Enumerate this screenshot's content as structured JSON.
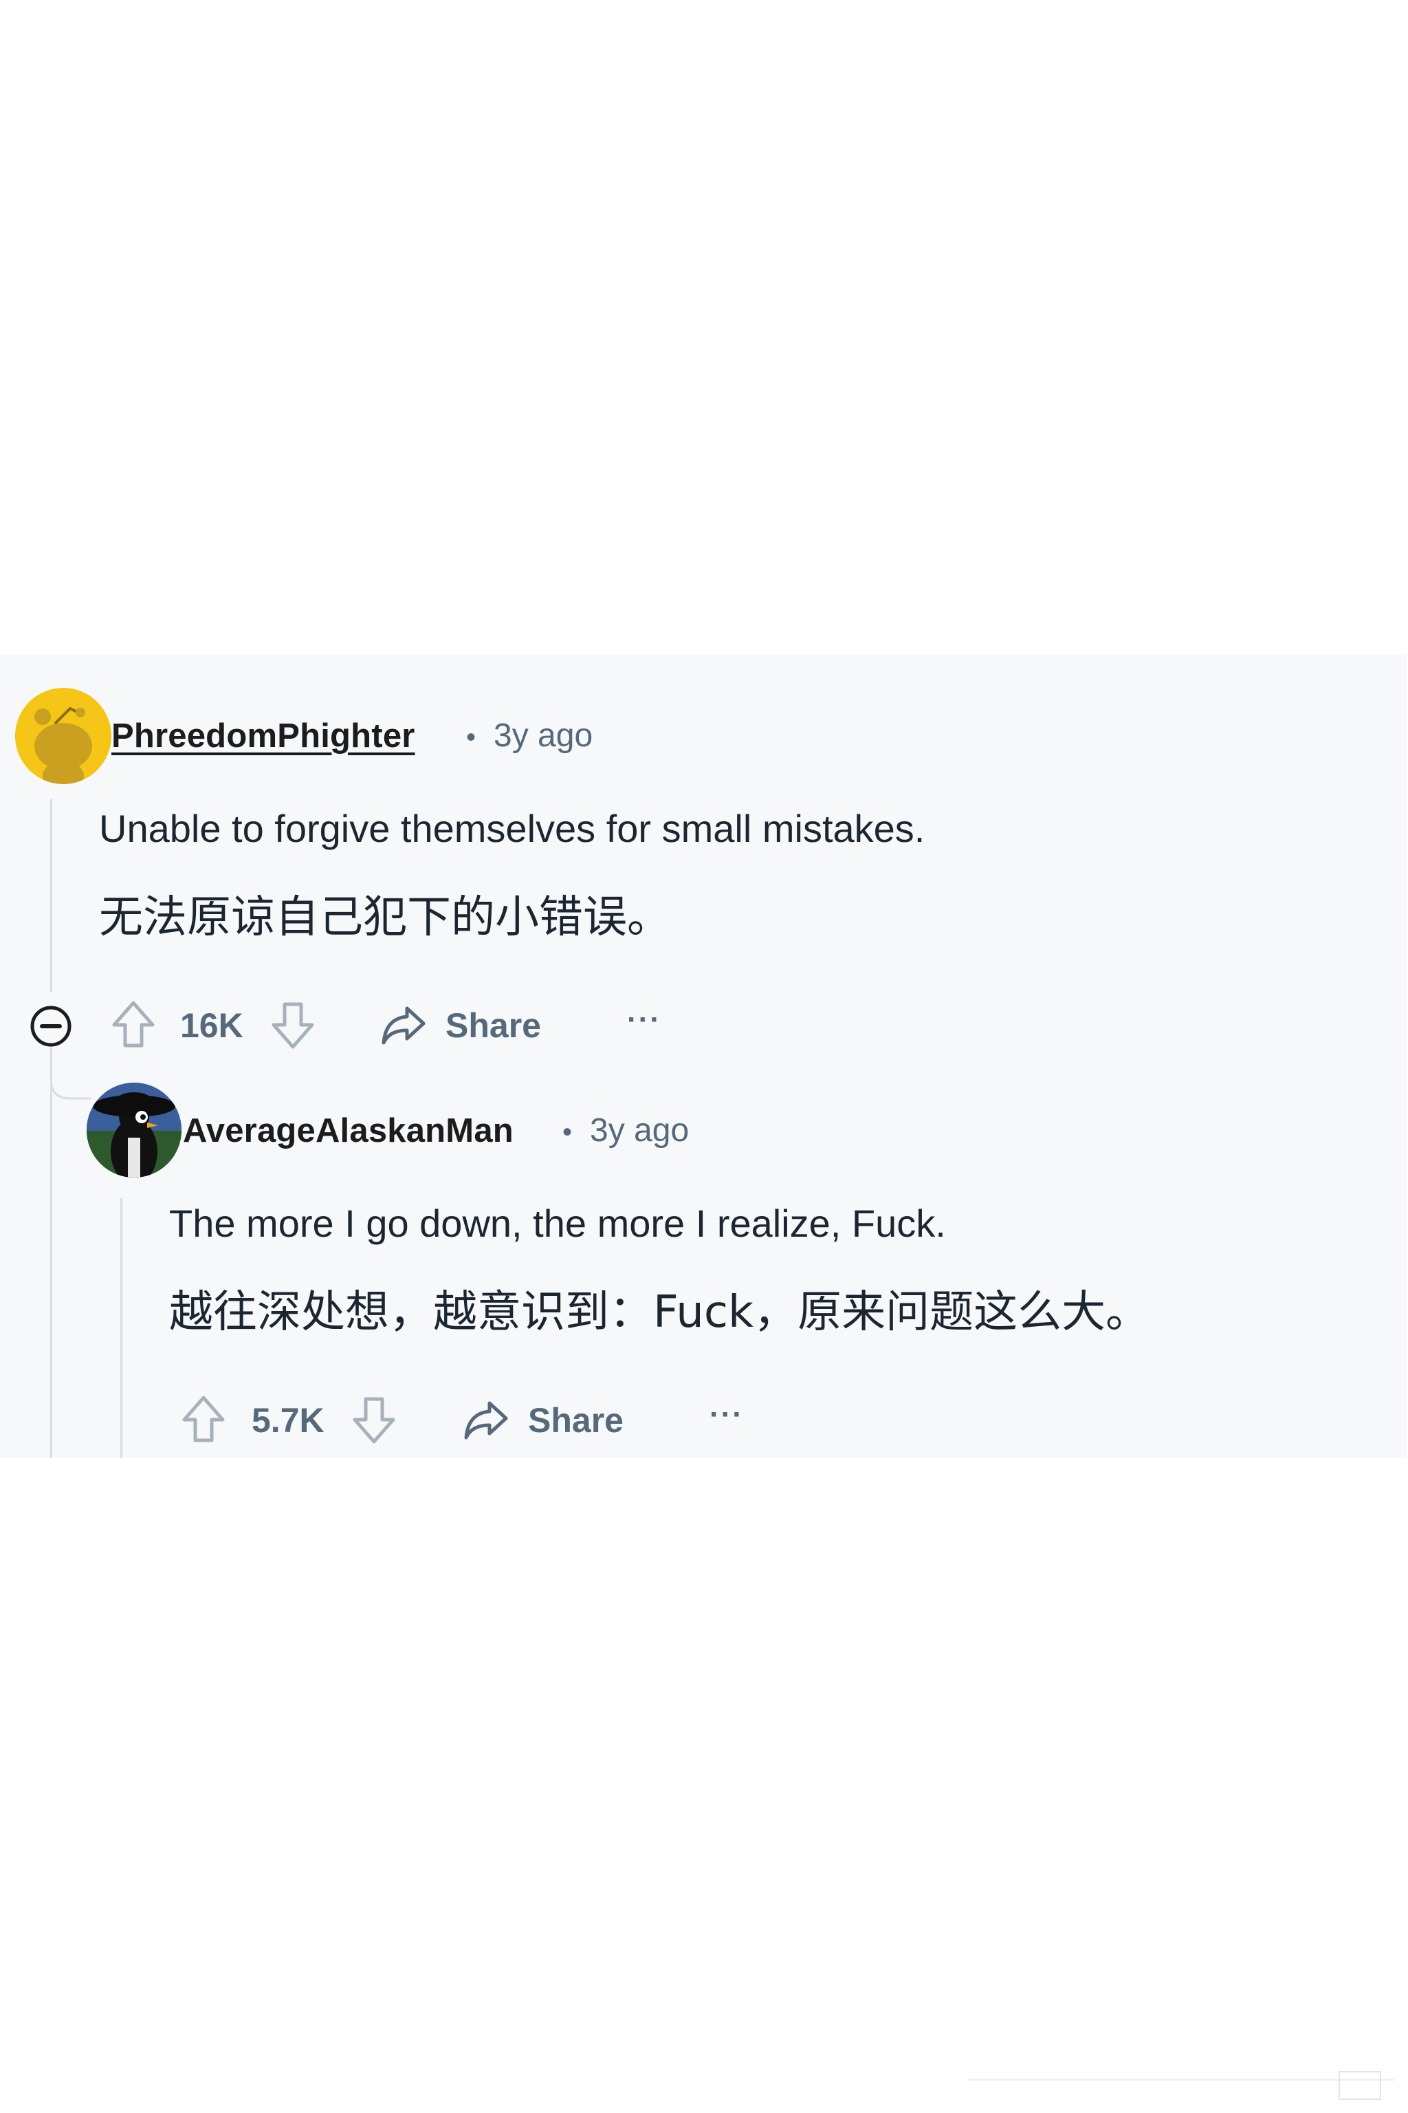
{
  "comments": [
    {
      "username": "PhreedomPhighter",
      "time": "3y ago",
      "separator": "•",
      "text_en": "Unable to forgive themselves for small mistakes.",
      "text_zh": "无法原谅自己犯下的小错误。",
      "votes": "16K",
      "share_label": "Share",
      "more_label": "···",
      "avatar_color": "#f5c518"
    },
    {
      "username": "AverageAlaskanMan",
      "time": "3y ago",
      "separator": "•",
      "text_en": "The more I go down, the more I realize, Fuck.",
      "text_zh": "越往深处想，越意识到：Fuck，原来问题这么大。",
      "votes": "5.7K",
      "share_label": "Share",
      "more_label": "···"
    }
  ],
  "colors": {
    "panel_bg": "#f7f8fa",
    "text_primary": "#1c1c1c",
    "text_secondary": "#56697a",
    "thread_line": "#d8dee4"
  }
}
